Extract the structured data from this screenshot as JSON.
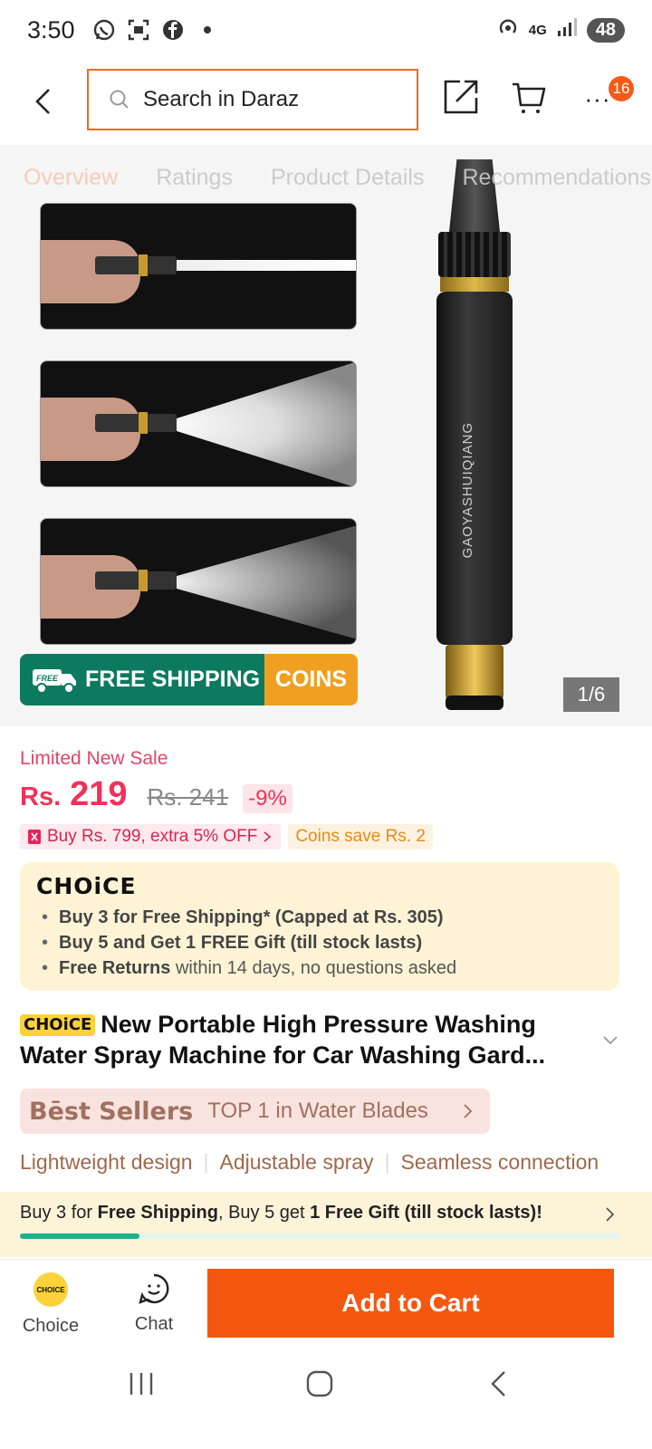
{
  "status_bar": {
    "time": "3:50",
    "network": "4G",
    "battery": "48",
    "icons": [
      "whatsapp-icon",
      "screenshot-icon",
      "facebook-icon",
      "dot-icon"
    ]
  },
  "header": {
    "search_placeholder": "Search in Daraz",
    "cart_badge": "16",
    "more_label": "···"
  },
  "tabs": [
    "Overview",
    "Ratings",
    "Product Details",
    "Recommendations"
  ],
  "gallery": {
    "product_brand_text": "GAOYASHUIQIANG",
    "shipping_label": "FREE SHIPPING",
    "shipping_badge_text": "FREE",
    "coins_label": "COINS",
    "counter": "1/6"
  },
  "pricing": {
    "sale_label": "Limited New Sale",
    "currency": "Rs.",
    "price": "219",
    "old_price": "Rs. 241",
    "discount": "-9%",
    "promo": "Buy Rs. 799, extra 5% OFF",
    "coins_save": "Coins save Rs. 2"
  },
  "choice": {
    "logo": "CHOiCE",
    "items": [
      {
        "bold": "Buy 3 for  Free Shipping* (Capped at Rs. 305)",
        "rest": ""
      },
      {
        "bold": "Buy 5 and Get 1 FREE Gift (till stock lasts)",
        "rest": ""
      },
      {
        "bold": "Free Returns",
        "rest": " within 14 days, no questions asked"
      }
    ]
  },
  "product": {
    "tag": "CHOiCE",
    "title": "New Portable High Pressure Washing Water Spray Machine for Car Washing Gard..."
  },
  "bestseller": {
    "brand": "Bēst Sellers",
    "text": "TOP 1 in Water Blades"
  },
  "features": [
    "Lightweight design",
    "Adjustable spray",
    "Seamless connection"
  ],
  "shipping_bar": {
    "part1": "Buy 3 for ",
    "bold1": "Free Shipping",
    "part2": ", Buy 5 get ",
    "bold2": "1 Free Gift (till stock lasts)!",
    "progress": 0.2
  },
  "bottom": {
    "choice_label": "Choice",
    "choice_icon_text": "CHOICE",
    "chat_label": "Chat",
    "add_to_cart": "Add to Cart"
  },
  "colors": {
    "accent": "#f5570f",
    "price": "#f0325a",
    "shipping_green": "#0c7a5e",
    "coins_orange": "#f0a020",
    "choice_bg": "#fef4d5"
  }
}
